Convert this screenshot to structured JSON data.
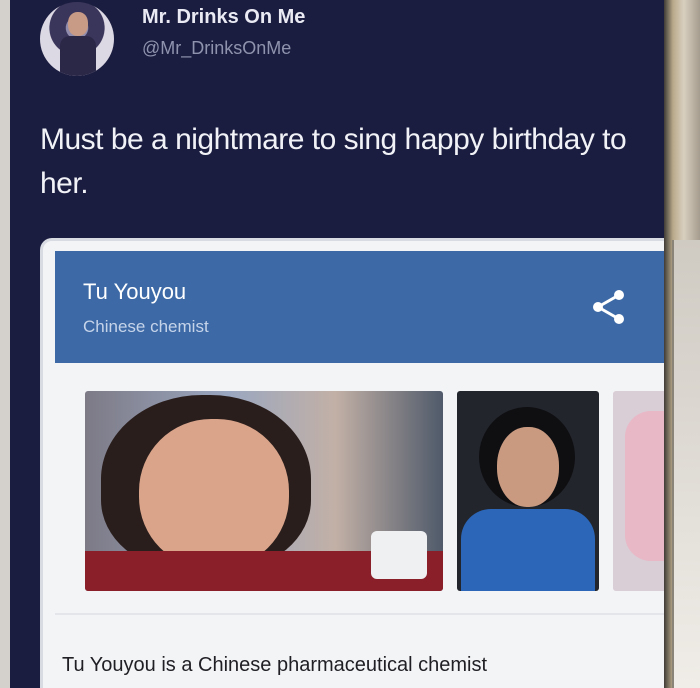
{
  "tweet": {
    "author_name": "Mr. Drinks On Me",
    "author_handle": "@Mr_DrinksOnMe",
    "text": "Must be a nightmare to sing happy birthday to her."
  },
  "knowledge_panel": {
    "title": "Tu Youyou",
    "subtitle": "Chinese chemist",
    "description": "Tu Youyou is a Chinese pharmaceutical chemist"
  },
  "colors": {
    "tweet_background": "#1b1d40",
    "panel_header": "#3d6aa6"
  },
  "icons": {
    "share": "share-icon"
  }
}
